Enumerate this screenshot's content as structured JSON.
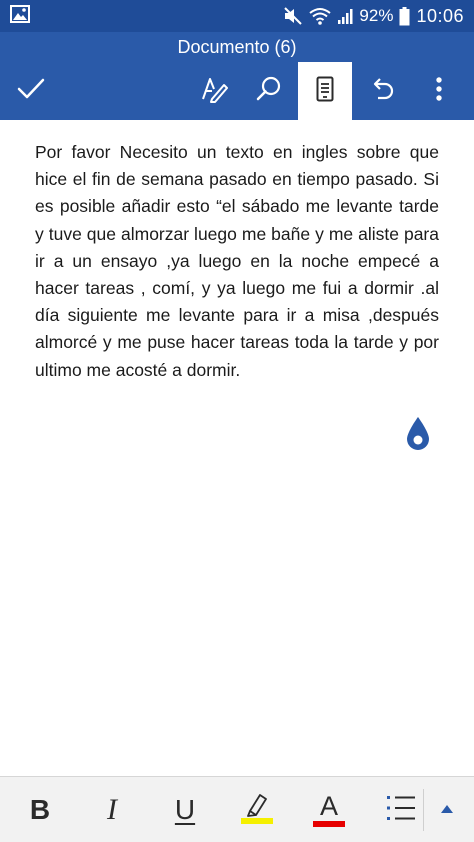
{
  "status_bar": {
    "battery_percent": "92%",
    "time": "10:06",
    "icons": [
      "gallery-icon",
      "mute-icon",
      "wifi-icon",
      "signal-icon",
      "battery-icon"
    ]
  },
  "app": {
    "title": "Documento (6)"
  },
  "toolbar": {
    "buttons": [
      "check-icon",
      "format-pen-icon",
      "search-icon",
      "reading-view-icon",
      "undo-icon",
      "more-vert-icon"
    ],
    "active_button": "reading-view-icon"
  },
  "document": {
    "text": "Por favor Necesito un texto en ingles sobre que hice el fin de semana pasado en tiempo pasado. Si es posible añadir esto “el sábado me levante tarde y tuve que almorzar luego me bañe y me aliste para ir a un ensayo ,ya luego en la noche empecé a hacer tareas , comí, y ya luego me fui a dormir .al día siguiente me levante para ir a misa ,después almorcé y me puse hacer tareas toda la tarde y por ultimo me acosté a dormir."
  },
  "format_bar": {
    "bold": "B",
    "italic": "I",
    "underline": "U",
    "font_color_letter": "A",
    "highlight_color": "#f5f000",
    "font_color": "#e60000"
  },
  "colors": {
    "brand": "#2a5aa9",
    "status_bar": "#1f4c98",
    "cursor_handle": "#2a5aa9"
  }
}
